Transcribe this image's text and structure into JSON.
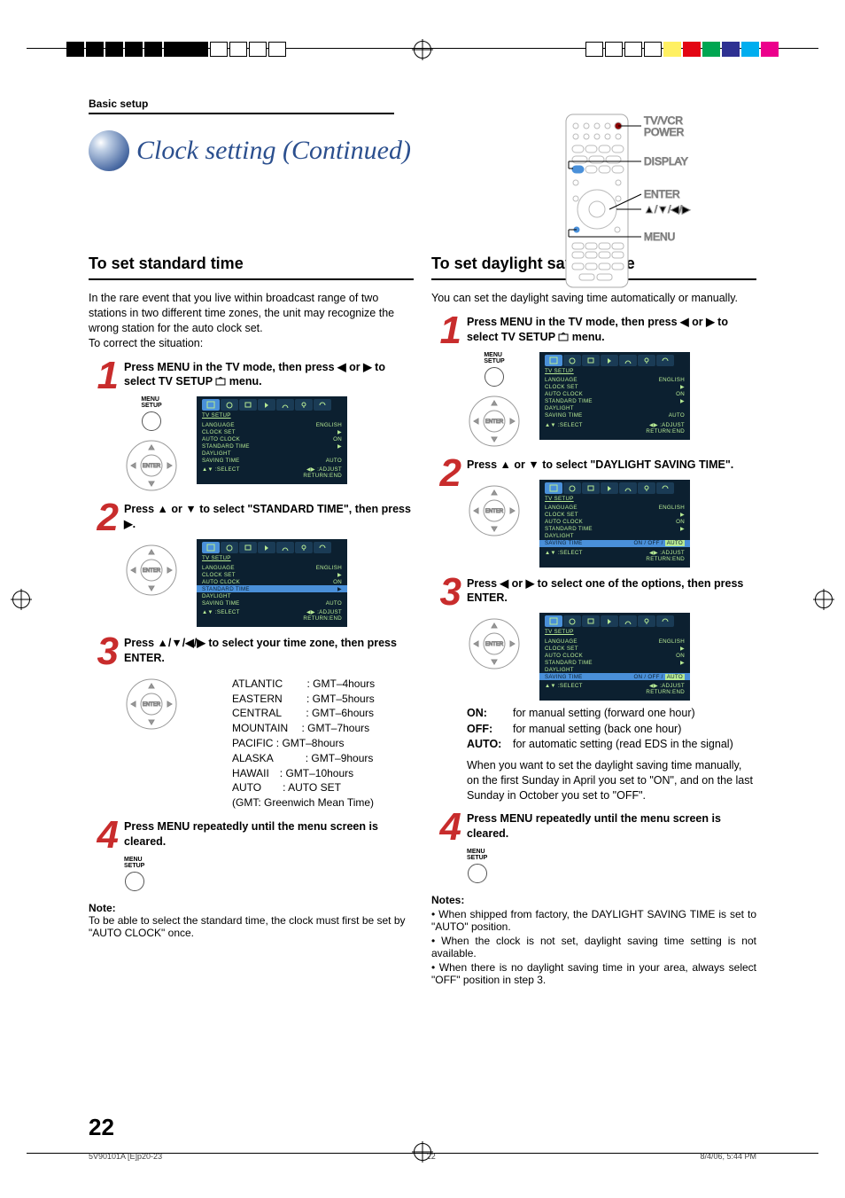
{
  "section": "Basic setup",
  "title": "Clock setting (Continued)",
  "remote": {
    "labels": [
      "TV/VCR POWER",
      "DISPLAY",
      "ENTER",
      "▲/▼/◀/▶",
      "MENU"
    ]
  },
  "left": {
    "heading": "To set standard time",
    "intro": "In the rare event that you live within broadcast range of two stations in two different time zones, the unit may recognize the wrong station for the auto clock set.\nTo correct the situation:",
    "steps": [
      {
        "num": "1",
        "text_a": "Press MENU in the TV mode, then press ◀ or ▶ to select TV SETUP ",
        "text_b": " menu.",
        "osd": {
          "title": "TV SETUP",
          "rows": [
            [
              "LANGUAGE",
              "ENGLISH"
            ],
            [
              "CLOCK SET",
              "▶"
            ],
            [
              "AUTO CLOCK",
              "ON"
            ],
            [
              "STANDARD TIME",
              "▶"
            ],
            [
              "DAYLIGHT",
              ""
            ],
            [
              "  SAVING TIME",
              "AUTO"
            ]
          ],
          "hl": -1,
          "foot": [
            "▲▼ :SELECT",
            "◀▶ :ADJUST",
            "RETURN:END"
          ]
        }
      },
      {
        "num": "2",
        "text_a": "Press ▲ or ▼ to select \"STANDARD TIME\", then press ▶.",
        "text_b": "",
        "no_menu_btn": true,
        "osd": {
          "title": "TV SETUP",
          "rows": [
            [
              "LANGUAGE",
              "ENGLISH"
            ],
            [
              "CLOCK SET",
              "▶"
            ],
            [
              "AUTO CLOCK",
              "ON"
            ],
            [
              "STANDARD TIME",
              "▶"
            ],
            [
              "DAYLIGHT",
              ""
            ],
            [
              "  SAVING TIME",
              "AUTO"
            ]
          ],
          "hl": 3,
          "foot": [
            "▲▼ :SELECT",
            "◀▶ :ADJUST",
            "RETURN:END"
          ]
        }
      },
      {
        "num": "3",
        "text_a": "Press ▲/▼/◀/▶ to select your time zone, then press ENTER.",
        "text_b": "",
        "no_menu_btn": true,
        "tz": [
          "ATLANTIC   : GMT–4hours",
          "EASTERN   : GMT–5hours",
          "CENTRAL   : GMT–6hours",
          "MOUNTAIN   : GMT–7hours",
          "PACIFIC : GMT–8hours",
          "ALASKA   : GMT–9hours",
          "HAWAII : GMT–10hours",
          "AUTO  : AUTO SET",
          "(GMT: Greenwich Mean Time)"
        ]
      },
      {
        "num": "4",
        "text_a": "Press MENU repeatedly until the menu screen is cleared.",
        "text_b": "",
        "only_menu_btn": true
      }
    ],
    "note_head": "Note:",
    "note_body": "To be able to select the standard time, the clock must first be set by \"AUTO CLOCK\" once."
  },
  "right": {
    "heading": "To set daylight saving time",
    "intro": "You can set the daylight saving time automatically or manually.",
    "steps": [
      {
        "num": "1",
        "text_a": "Press MENU in the TV mode, then press ◀ or ▶ to select TV SETUP ",
        "text_b": " menu.",
        "osd": {
          "title": "TV SETUP",
          "rows": [
            [
              "LANGUAGE",
              "ENGLISH"
            ],
            [
              "CLOCK SET",
              "▶"
            ],
            [
              "AUTO CLOCK",
              "ON"
            ],
            [
              "STANDARD TIME",
              "▶"
            ],
            [
              "DAYLIGHT",
              ""
            ],
            [
              "  SAVING TIME",
              "AUTO"
            ]
          ],
          "hl": -1,
          "foot": [
            "▲▼ :SELECT",
            "◀▶ :ADJUST",
            "RETURN:END"
          ]
        }
      },
      {
        "num": "2",
        "text_a": "Press ▲ or ▼ to select \"DAYLIGHT SAVING TIME\".",
        "text_b": "",
        "no_menu_btn": true,
        "osd": {
          "title": "TV SETUP",
          "rows": [
            [
              "LANGUAGE",
              "ENGLISH"
            ],
            [
              "CLOCK SET",
              "▶"
            ],
            [
              "AUTO CLOCK",
              "ON"
            ],
            [
              "STANDARD TIME",
              "▶"
            ],
            [
              "DAYLIGHT",
              ""
            ],
            [
              "  SAVING TIME",
              "ON / OFF / AUTO"
            ]
          ],
          "hl": 5,
          "hlbox": true,
          "foot": [
            "▲▼ :SELECT",
            "◀▶ :ADJUST",
            "RETURN:END"
          ]
        }
      },
      {
        "num": "3",
        "text_a": "Press ◀ or ▶ to select one of the options, then press ENTER.",
        "text_b": "",
        "no_menu_btn": true,
        "osd": {
          "title": "TV SETUP",
          "rows": [
            [
              "LANGUAGE",
              "ENGLISH"
            ],
            [
              "CLOCK SET",
              "▶"
            ],
            [
              "AUTO CLOCK",
              "ON"
            ],
            [
              "STANDARD TIME",
              "▶"
            ],
            [
              "DAYLIGHT",
              ""
            ],
            [
              "  SAVING TIME",
              "ON / OFF / AUTO"
            ]
          ],
          "hl": 5,
          "hlbox": true,
          "foot": [
            "▲▼ :SELECT",
            "◀▶ :ADJUST",
            "RETURN:END"
          ]
        },
        "options": [
          [
            "ON:",
            "for manual setting (forward one hour)"
          ],
          [
            "OFF:",
            "for manual setting (back one hour)"
          ],
          [
            "AUTO:",
            "for automatic setting (read EDS in the signal)"
          ]
        ],
        "after": "When you want to set the daylight saving time manually, on the first Sunday in April you set to \"ON\", and on the last Sunday in October you set to \"OFF\"."
      },
      {
        "num": "4",
        "text_a": "Press MENU repeatedly until the menu screen is cleared.",
        "text_b": "",
        "only_menu_btn": true
      }
    ],
    "notes_head": "Notes:",
    "notes": [
      "When shipped from factory, the DAYLIGHT SAVING TIME is set to \"AUTO\" position.",
      "When the clock is not set, daylight saving time setting is not available.",
      "When there is no daylight saving time in your area, always select \"OFF\" position in step 3."
    ]
  },
  "page_number": "22",
  "footer": {
    "left": "5V90101A [E]p20-23",
    "center": "22",
    "right": "8/4/06, 5:44 PM"
  }
}
